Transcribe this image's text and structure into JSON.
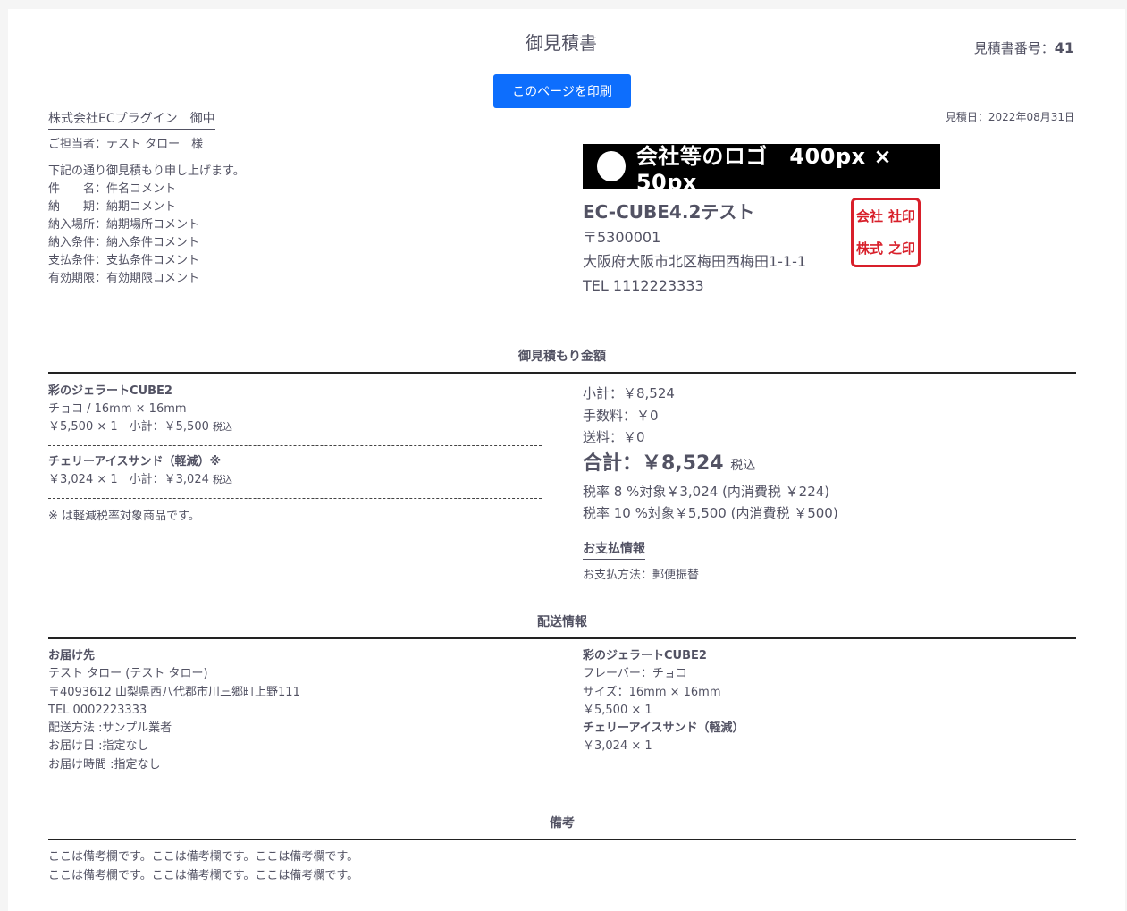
{
  "header": {
    "title": "御見積書",
    "quote_number_label": "見積書番号：",
    "quote_number": "41",
    "print_button": "このページを印刷",
    "quote_date": "見積日：2022年08月31日"
  },
  "customer": {
    "company": "株式会社ECプラグイン　御中",
    "contact": "ご担当者：テスト タロー　様",
    "intro": "下記の通り御見積もり申し上げます。",
    "details": [
      "件　　名：件名コメント",
      "納　　期：納期コメント",
      "納入場所：納期場所コメント",
      "納入条件：納入条件コメント",
      "支払条件：支払条件コメント",
      "有効期限：有効期限コメント"
    ]
  },
  "shop": {
    "logo_text": "会社等のロゴ　400px × 50px",
    "name": "EC-CUBE4.2テスト",
    "postal": "〒5300001",
    "address": "大阪府大阪市北区梅田西梅田1-1-1",
    "tel": "TEL 1112223333",
    "seal_chars": [
      "社印",
      "株式",
      "会社",
      "之印"
    ]
  },
  "estimate": {
    "section_title": "御見積もり金額",
    "items": [
      {
        "name": "彩のジェラートCUBE2",
        "option": "チョコ / 16mm × 16mm",
        "price_line": "￥5,500 × 1　小計：￥5,500",
        "tax_label": "税込"
      },
      {
        "name": "チェリーアイスサンド（軽減）※",
        "price_line": "￥3,024 × 1　小計：￥3,024",
        "tax_label": "税込"
      }
    ],
    "note": "※ は軽減税率対象商品です。",
    "subtotal": "小計：￥8,524",
    "fee": "手数料：￥0",
    "shipping": "送料：￥0",
    "total": "合計：￥8,524",
    "total_tax_label": "税込",
    "tax_8": "税率 8 %対象￥3,024 (内消費税 ￥224)",
    "tax_10": "税率 10 %対象￥5,500 (内消費税 ￥500)"
  },
  "payment": {
    "title": "お支払情報",
    "method": "お支払方法：郵便振替"
  },
  "shipping": {
    "section_title": "配送情報",
    "dest_title": "お届け先",
    "name": "テスト タロー (テスト タロー)",
    "address": "〒4093612 山梨県西八代郡市川三郷町上野111",
    "tel": "TEL 0002223333",
    "method": "配送方法 :サンプル業者",
    "date": "お届け日 :指定なし",
    "time": "お届け時間 :指定なし",
    "products": [
      {
        "name": "彩のジェラートCUBE2",
        "lines": [
          "フレーバー：チョコ",
          "サイズ：16mm × 16mm",
          "￥5,500 × 1"
        ]
      },
      {
        "name": "チェリーアイスサンド（軽減）",
        "lines": [
          "￥3,024 × 1"
        ]
      }
    ]
  },
  "remarks": {
    "section_title": "備考",
    "lines": [
      "ここは備考欄です。ここは備考欄です。ここは備考欄です。",
      "ここは備考欄です。ここは備考欄です。ここは備考欄です。"
    ]
  }
}
